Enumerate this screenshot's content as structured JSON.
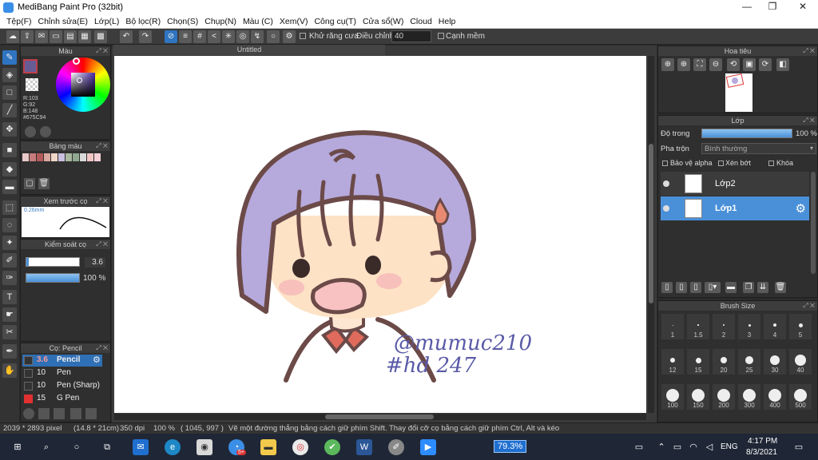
{
  "window": {
    "title": "MediBang Paint Pro (32bit)",
    "min": "—",
    "max": "❐",
    "close": "✕"
  },
  "menu": [
    "Tệp(F)",
    "Chỉnh sửa(E)",
    "Lớp(L)",
    "Bộ lọc(R)",
    "Chọn(S)",
    "Chụp(N)",
    "Màu (C)",
    "Xem(V)",
    "Công cụ(T)",
    "Cửa sổ(W)",
    "Cloud",
    "Help"
  ],
  "toolbar": {
    "antialias_label": "Khử răng cưa",
    "adjust_label": "Điều chỉnh",
    "adjust_value": "40",
    "smooth_label": "Cạnh mềm"
  },
  "doc": {
    "tab": "Untitled"
  },
  "color_panel": {
    "title": "Màu",
    "r": "R:103",
    "g": "G:92",
    "b": "B:148",
    "hex": "#675C94",
    "fg": "#675c94"
  },
  "palette_panel": {
    "title": "Bảng màu",
    "colors": [
      "#e8c9c9",
      "#c77b7b",
      "#b35a5a",
      "#d9a9a0",
      "#f0d8c8",
      "#c9c0e0",
      "#a8b8a0",
      "#8fa88f",
      "#d9d9d9",
      "#f2c4c4",
      "#f5d0d6"
    ]
  },
  "preview_panel": {
    "title": "Xem trước cọ",
    "size_text": "0.26mm"
  },
  "brush_control": {
    "title": "Kiểm soát cọ",
    "size_value": "3.6",
    "opacity_value": "100 %",
    "opacity_fraction": 1.0
  },
  "brush_list": {
    "title": "Cọ: Pencil",
    "items": [
      {
        "size": "3.6",
        "name": "Pencil",
        "color": "#333333"
      },
      {
        "size": "10",
        "name": "Pen",
        "color": "#333333"
      },
      {
        "size": "10",
        "name": "Pen (Sharp)",
        "color": "#333333"
      },
      {
        "size": "15",
        "name": "G Pen",
        "color": "#e03030"
      }
    ]
  },
  "navigator": {
    "title": "Hoa tiêu"
  },
  "layer_panel": {
    "title": "Lớp",
    "opacity_label": "Độ trong",
    "opacity_value": "100 %",
    "opacity_fraction": 1.0,
    "blend_label": "Pha trộn",
    "blend_value": "Bình thường",
    "protect_alpha": "Bảo vệ alpha",
    "clipping": "Xén bớt",
    "lock": "Khóa",
    "layers": [
      "Lớp2",
      "Lớp1"
    ]
  },
  "brush_size_panel": {
    "title": "Brush Size",
    "sizes": [
      "1",
      "1.5",
      "2",
      "3",
      "4",
      "5",
      "12",
      "15",
      "20",
      "25",
      "30",
      "40",
      "100",
      "150",
      "200",
      "300",
      "400",
      "500"
    ]
  },
  "status": {
    "dimensions": "2039 * 2893 pixel",
    "physical": "(14.8 * 21cm)",
    "dpi": "350 dpi",
    "zoom": "100 %",
    "coords": "( 1045, 997 )",
    "hint": "Vẽ một đường thẳng bằng cách giữ phím Shift. Thay đổi cỡ cọ bằng cách giữ phím Ctrl, Alt và kéo"
  },
  "taskbar": {
    "zoom_badge": "79.3%",
    "badge_count": "5+",
    "lang": "ENG",
    "time": "4:17 PM",
    "date": "8/3/2021"
  },
  "artwork": {
    "line1": "@mumuc210",
    "line2": "#hd 247"
  }
}
